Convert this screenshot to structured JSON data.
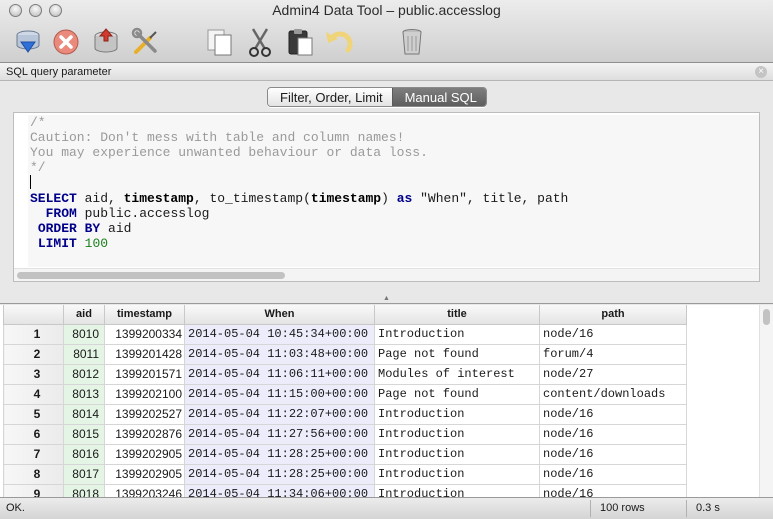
{
  "window": {
    "title": "Admin4 Data Tool – public.accesslog"
  },
  "toolbar": {
    "buttons": [
      {
        "name": "refresh-button",
        "icon": "database-download-icon"
      },
      {
        "name": "cancel-button",
        "icon": "stop-icon"
      },
      {
        "name": "save-data-button",
        "icon": "database-save-icon"
      },
      {
        "name": "tools-button",
        "icon": "wrench-screwdriver-icon"
      },
      {
        "name": "copy-button",
        "icon": "copy-icon"
      },
      {
        "name": "cut-button",
        "icon": "scissors-icon"
      },
      {
        "name": "paste-button",
        "icon": "clipboard-icon"
      },
      {
        "name": "undo-button",
        "icon": "undo-arrow-icon"
      },
      {
        "name": "delete-button",
        "icon": "trash-icon"
      }
    ]
  },
  "panel": {
    "title": "SQL query parameter",
    "tabs": [
      {
        "label": "Filter, Order, Limit",
        "active": false
      },
      {
        "label": "Manual SQL",
        "active": true
      }
    ]
  },
  "editor": {
    "comment_lines": [
      "/*",
      "Caution: Don't mess with table and column names!",
      "You may experience unwanted behaviour or data loss.",
      "*/"
    ],
    "kw_select": "SELECT",
    "sel_aid": " aid, ",
    "sel_timestamp": "timestamp",
    "sel_comma": ", ",
    "sel_fn": "to_timestamp",
    "sel_open": "(",
    "sel_arg": "timestamp",
    "sel_close": ") ",
    "kw_as": "as",
    "sel_rest": " \"When\", title, path",
    "kw_from": "FROM",
    "from_table": " public.accesslog",
    "kw_order": "ORDER BY",
    "order_col": " aid",
    "kw_limit": "LIMIT",
    "limit_value": "100"
  },
  "grid": {
    "columns": [
      "",
      "aid",
      "timestamp",
      "When",
      "title",
      "path"
    ],
    "rows": [
      {
        "n": "1",
        "aid": "8010",
        "timestamp": "1399200334",
        "when": "2014-05-04 10:45:34+00:00",
        "title": "Introduction",
        "path": "node/16"
      },
      {
        "n": "2",
        "aid": "8011",
        "timestamp": "1399201428",
        "when": "2014-05-04 11:03:48+00:00",
        "title": "Page not found",
        "path": "forum/4"
      },
      {
        "n": "3",
        "aid": "8012",
        "timestamp": "1399201571",
        "when": "2014-05-04 11:06:11+00:00",
        "title": "Modules of interest",
        "path": "node/27"
      },
      {
        "n": "4",
        "aid": "8013",
        "timestamp": "1399202100",
        "when": "2014-05-04 11:15:00+00:00",
        "title": "Page not found",
        "path": "content/downloads"
      },
      {
        "n": "5",
        "aid": "8014",
        "timestamp": "1399202527",
        "when": "2014-05-04 11:22:07+00:00",
        "title": "Introduction",
        "path": "node/16"
      },
      {
        "n": "6",
        "aid": "8015",
        "timestamp": "1399202876",
        "when": "2014-05-04 11:27:56+00:00",
        "title": "Introduction",
        "path": "node/16"
      },
      {
        "n": "7",
        "aid": "8016",
        "timestamp": "1399202905",
        "when": "2014-05-04 11:28:25+00:00",
        "title": "Introduction",
        "path": "node/16"
      },
      {
        "n": "8",
        "aid": "8017",
        "timestamp": "1399202905",
        "when": "2014-05-04 11:28:25+00:00",
        "title": "Introduction",
        "path": "node/16"
      },
      {
        "n": "9",
        "aid": "8018",
        "timestamp": "1399203246",
        "when": "2014-05-04 11:34:06+00:00",
        "title": "Introduction",
        "path": "node/16"
      }
    ]
  },
  "status": {
    "message": "OK.",
    "rows": "100 rows",
    "time": "0.3 s"
  },
  "colors": {
    "aid_column": "#e5f5e5",
    "when_column": "#ececfb",
    "sql_keyword": "#00008b",
    "sql_comment": "#9a9a9a",
    "sql_number": "#1a7f1a",
    "active_tab": "#6e6e6e"
  }
}
